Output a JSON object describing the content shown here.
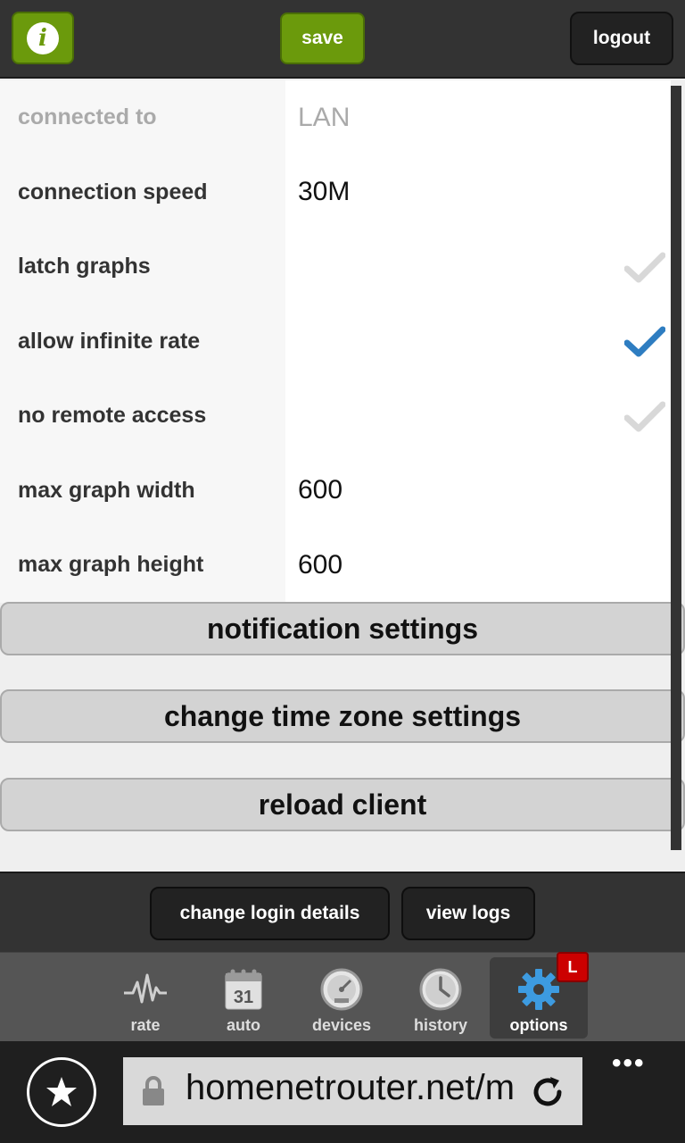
{
  "header": {
    "info_icon_glyph": "i",
    "save_label": "save",
    "logout_label": "logout"
  },
  "settings": {
    "connected_to": {
      "label": "connected to",
      "value": "LAN"
    },
    "connection_speed": {
      "label": "connection speed",
      "value": "30M"
    },
    "latch_graphs": {
      "label": "latch graphs",
      "checked": false
    },
    "allow_infinite_rate": {
      "label": "allow infinite rate",
      "checked": true
    },
    "no_remote_access": {
      "label": "no remote access",
      "checked": false
    },
    "max_graph_width": {
      "label": "max graph width",
      "value": "600"
    },
    "max_graph_height": {
      "label": "max graph height",
      "value": "600"
    }
  },
  "actions": {
    "notification_settings": "notification settings",
    "change_time_zone": "change time zone settings",
    "reload_client": "reload client"
  },
  "subbar": {
    "change_login": "change login details",
    "view_logs": "view logs"
  },
  "nav": {
    "rate": "rate",
    "auto": "auto",
    "auto_calendar_day": "31",
    "devices": "devices",
    "history": "history",
    "options": "options",
    "options_badge": "L"
  },
  "browser": {
    "url": "homenetrouter.net/m",
    "menu_dots": "•••"
  },
  "colors": {
    "accent_green": "#6b9a0c",
    "check_on": "#2e7dc1",
    "check_off": "#d8d8d8",
    "badge_red": "#cc0000"
  }
}
